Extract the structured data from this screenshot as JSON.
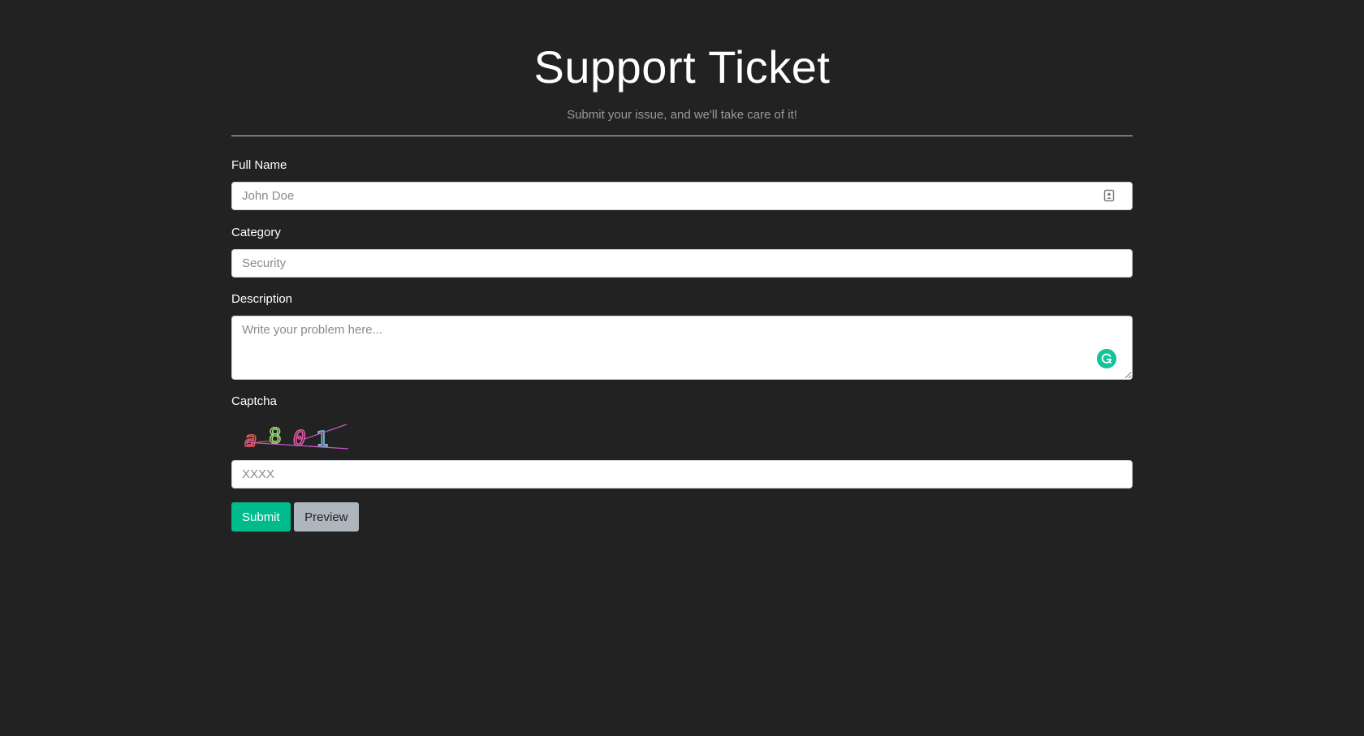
{
  "header": {
    "title": "Support Ticket",
    "subtitle": "Submit your issue, and we'll take care of it!"
  },
  "form": {
    "full_name": {
      "label": "Full Name",
      "placeholder": "John Doe",
      "value": ""
    },
    "category": {
      "label": "Category",
      "placeholder": "Security",
      "value": ""
    },
    "description": {
      "label": "Description",
      "placeholder": "Write your problem here...",
      "value": ""
    },
    "captcha": {
      "label": "Captcha",
      "image_text": "a801",
      "placeholder": "XXXX",
      "value": ""
    }
  },
  "buttons": {
    "submit_label": "Submit",
    "preview_label": "Preview"
  },
  "icons": {
    "name_field_icon": "contact-card-icon",
    "description_field_icon": "grammarly-icon"
  },
  "colors": {
    "background": "#222222",
    "accent": "#00bc8c",
    "secondary": "#adb5bd"
  }
}
